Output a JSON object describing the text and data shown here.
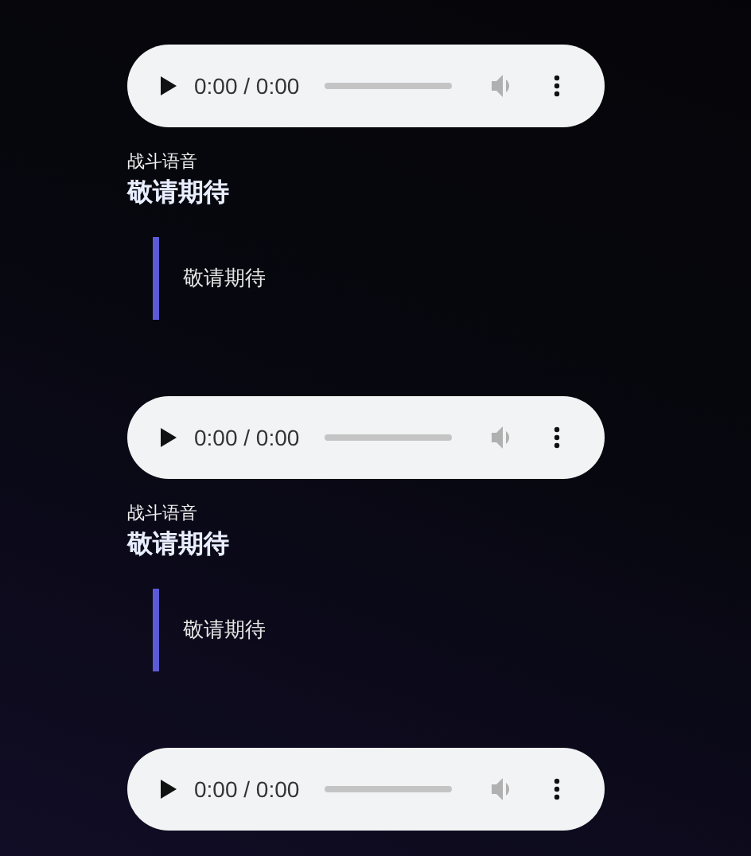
{
  "entries": [
    {
      "player": {
        "time": "0:00 / 0:00"
      },
      "label": "战斗语音",
      "title": "敬请期待",
      "quote": "敬请期待"
    },
    {
      "player": {
        "time": "0:00 / 0:00"
      },
      "label": "战斗语音",
      "title": "敬请期待",
      "quote": "敬请期待"
    },
    {
      "player": {
        "time": "0:00 / 0:00"
      }
    }
  ]
}
